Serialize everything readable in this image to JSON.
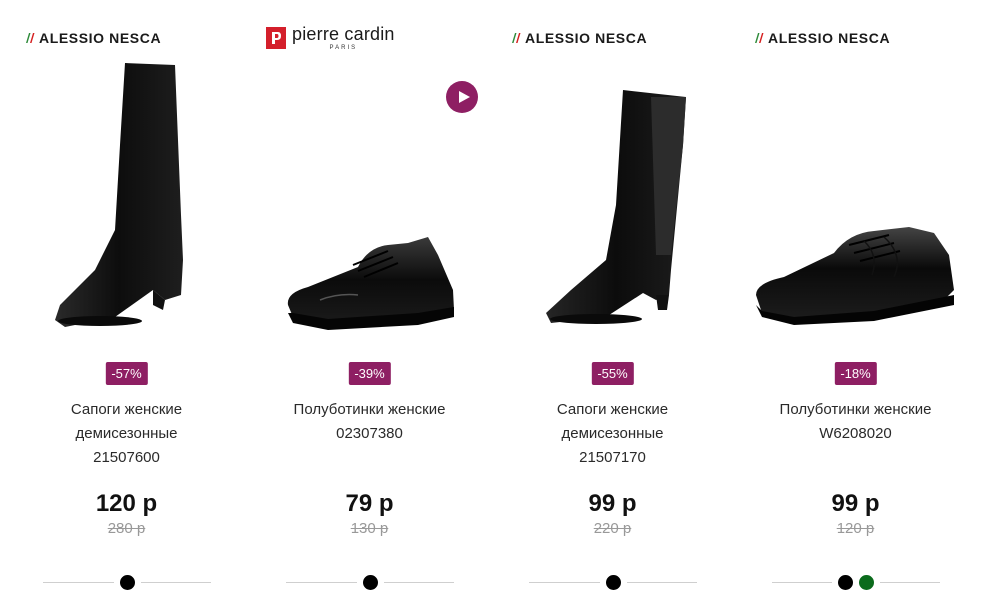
{
  "products": [
    {
      "brand": "ALESSIO NESCA",
      "discount": "-57%",
      "name_lines": [
        "Сапоги женские",
        "демисезонные",
        "21507600"
      ],
      "price": "120 р",
      "old_price": "280 р",
      "colors": [
        "#000000"
      ]
    },
    {
      "brand": "pierre cardin",
      "brand_sub": "PARIS",
      "discount": "-39%",
      "name_lines": [
        "Полуботинки женские",
        "02307380"
      ],
      "price": "79 р",
      "old_price": "130 р",
      "colors": [
        "#000000"
      ],
      "video_icon": "play-icon"
    },
    {
      "brand": "ALESSIO NESCA",
      "discount": "-55%",
      "name_lines": [
        "Сапоги женские",
        "демисезонные",
        "21507170"
      ],
      "price": "99 р",
      "old_price": "220 р",
      "colors": [
        "#000000"
      ]
    },
    {
      "brand": "ALESSIO NESCA",
      "discount": "-18%",
      "name_lines": [
        "Полуботинки женские",
        "W6208020"
      ],
      "price": "99 р",
      "old_price": "120 р",
      "colors": [
        "#000000",
        "#0b6b1c"
      ]
    }
  ],
  "theme": {
    "badge_color": "#8e1f63",
    "logo_green": "#2e8b3a",
    "logo_red": "#d62020",
    "pc_red": "#d41f2b"
  }
}
